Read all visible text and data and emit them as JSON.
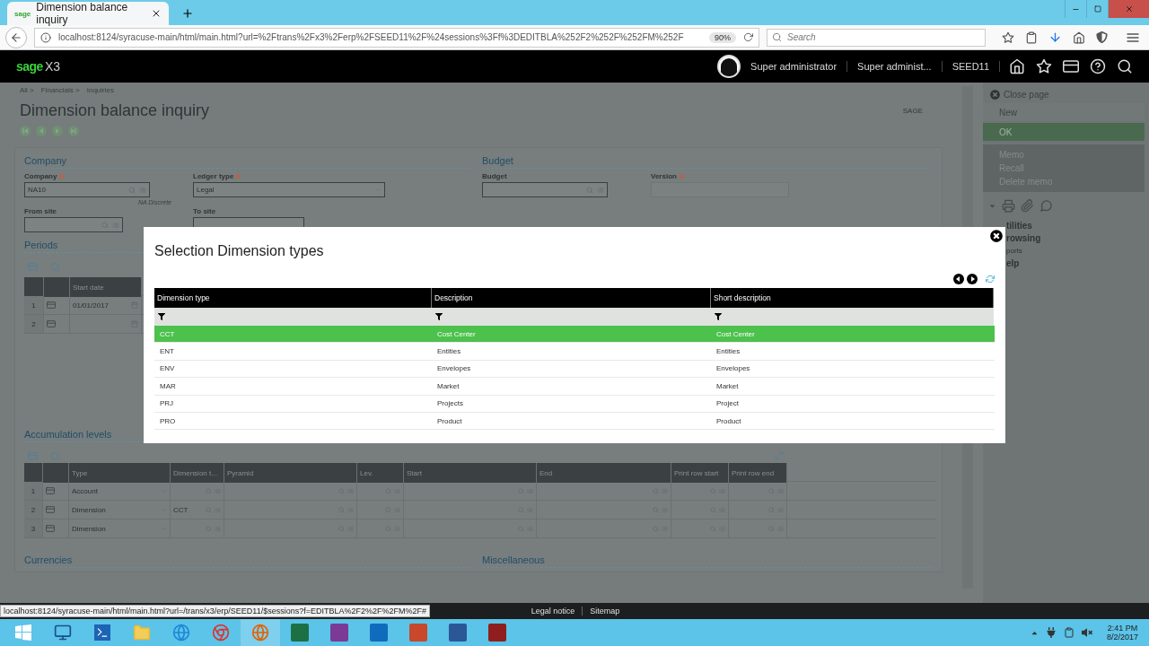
{
  "browser": {
    "tab": {
      "logo": "sage",
      "title": "Dimension balance inquiry"
    },
    "url": "localhost:8124/syracuse-main/html/main.html?url=%2Ftrans%2Fx3%2Ferp%2FSEED11%2F%24sessions%3Ff%3DEDITBLA%252F2%252F%252FM%252F",
    "zoom": "90%",
    "search": {
      "placeholder": "Search"
    }
  },
  "app_header": {
    "logo": {
      "brand": "sage",
      "product": "X3"
    },
    "user": "Super administrator",
    "role": "Super administ...",
    "folder": "SEED11"
  },
  "breadcrumb": [
    "All >",
    "Financials >",
    "Inquiries"
  ],
  "page": {
    "title": "Dimension balance inquiry",
    "user_code": "SAGE"
  },
  "company_section": {
    "title": "Company",
    "company": {
      "label": "Company",
      "required": true,
      "value": "NA10",
      "note": "NA Discrete"
    },
    "ledger_type": {
      "label": "Ledger type",
      "required": true,
      "value": "Legal"
    },
    "from_site": {
      "label": "From site"
    },
    "to_site": {
      "label": "To site"
    }
  },
  "budget_section": {
    "title": "Budget",
    "budget": {
      "label": "Budget"
    },
    "version": {
      "label": "Version",
      "required": true
    }
  },
  "periods": {
    "title": "Periods",
    "columns": [
      "Start date"
    ],
    "rows": [
      {
        "number": "1",
        "start_date": "01/01/2017"
      },
      {
        "number": "2"
      }
    ]
  },
  "accumulation_levels": {
    "title": "Accumulation levels",
    "columns": [
      "Type",
      "Dimension t...",
      "Pyramid",
      "Lev.",
      "Start",
      "End",
      "Print row start",
      "Print row end"
    ],
    "rows": [
      {
        "number": "1",
        "type": "Account"
      },
      {
        "number": "2",
        "type": "Dimension",
        "dimension_type": "CCT"
      },
      {
        "number": "3",
        "type": "Dimension"
      }
    ]
  },
  "currencies_section": {
    "title": "Currencies"
  },
  "miscellaneous_section": {
    "title": "Miscellaneous"
  },
  "right_panel": {
    "close": "Close page",
    "actions": [
      {
        "label": "New",
        "disabled": true
      },
      {
        "label": "OK",
        "disabled": false
      }
    ],
    "memo": [
      "Memo",
      "Recall",
      "Delete memo"
    ],
    "links": [
      {
        "label": "tilities",
        "kind": "heading"
      },
      {
        "label": "rowsing",
        "kind": "heading"
      },
      {
        "label": "ports",
        "kind": "item"
      },
      {
        "label": "elp",
        "kind": "heading"
      }
    ]
  },
  "dialog": {
    "title": "Selection Dimension types",
    "columns": [
      "Dimension type",
      "Description",
      "Short description"
    ],
    "rows": [
      {
        "dimension_type": "CCT",
        "description": "Cost Center",
        "short_description": "Cost Center",
        "selected": true
      },
      {
        "dimension_type": "ENT",
        "description": "Entities",
        "short_description": "Entities",
        "selected": false
      },
      {
        "dimension_type": "ENV",
        "description": "Envelopes",
        "short_description": "Envelopes",
        "selected": false
      },
      {
        "dimension_type": "MAR",
        "description": "Market",
        "short_description": "Market",
        "selected": false
      },
      {
        "dimension_type": "PRJ",
        "description": "Projects",
        "short_description": "Project",
        "selected": false
      },
      {
        "dimension_type": "PRO",
        "description": "Product",
        "short_description": "Product",
        "selected": false
      }
    ]
  },
  "status_link": "localhost:8124/syracuse-main/html/main.html?url=/trans/x3/erp/SEED11/$sessions?f=EDITBLA%2F2%2F%2FM%2F#",
  "footer": [
    "Legal notice",
    "Sitemap"
  ],
  "taskbar": {
    "time": "2:41 PM",
    "date": "8/2/2017"
  }
}
